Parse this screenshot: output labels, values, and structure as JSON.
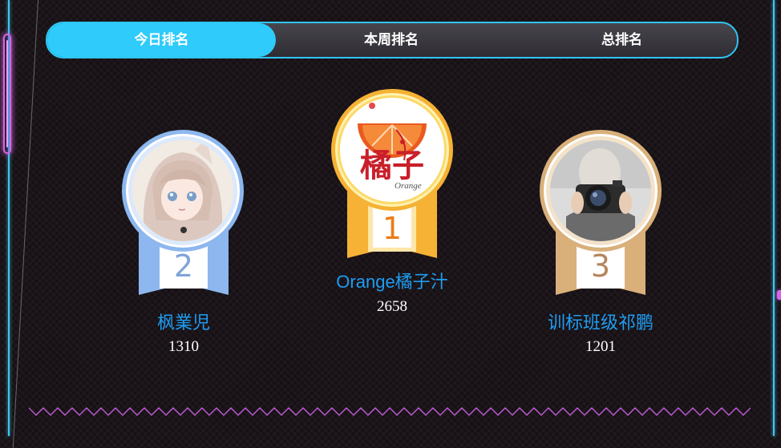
{
  "tabs": [
    {
      "label": "今日排名",
      "active": true
    },
    {
      "label": "本周排名",
      "active": false
    },
    {
      "label": "总排名",
      "active": false
    }
  ],
  "ranking": [
    {
      "rank": "2",
      "name": "枫業児",
      "score": "1310",
      "medal_color": "#8db7ee",
      "avatar": "anime-girl-avatar"
    },
    {
      "rank": "1",
      "name": "Orange橘子汁",
      "score": "2658",
      "medal_color": "#f5b235",
      "avatar": "orange-logo-avatar",
      "avatar_text": "橘子",
      "avatar_subtext": "Orange"
    },
    {
      "rank": "3",
      "name": "训标班级祁鹏",
      "score": "1201",
      "medal_color": "#d9b07a",
      "avatar": "camera-selfie-avatar"
    }
  ],
  "colors": {
    "accent": "#2ecbfb",
    "name": "#1e9df2",
    "glow": "#d765e6"
  }
}
